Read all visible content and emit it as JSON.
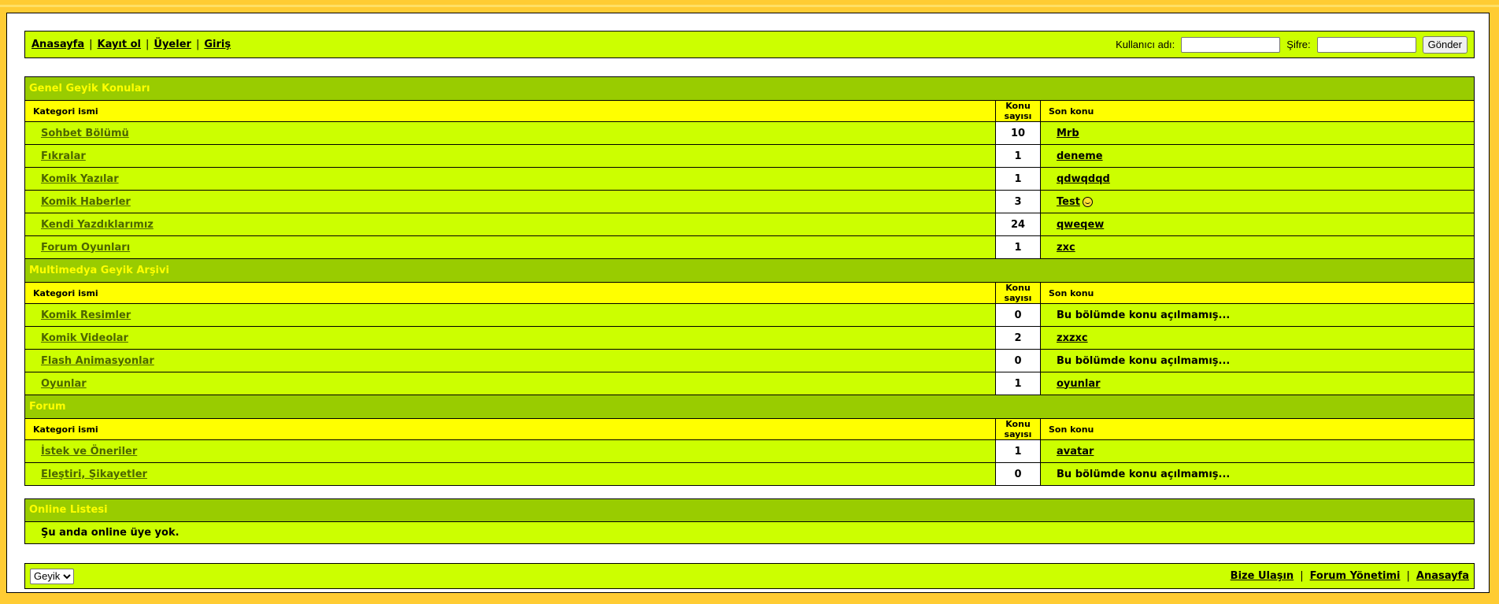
{
  "nav": {
    "links": [
      "Anasayfa",
      "Kayıt ol",
      "Üyeler",
      "Giriş"
    ],
    "username_label": "Kullanıcı adı:",
    "password_label": "Şifre:",
    "submit_label": "Gönder"
  },
  "columns": {
    "category": "Kategori ismi",
    "count": "Konu sayısı",
    "last": "Son konu"
  },
  "sections": [
    {
      "title": "Genel Geyik Konuları",
      "rows": [
        {
          "name": "Sohbet Bölümü",
          "count": "10",
          "last": "Mrb"
        },
        {
          "name": "Fıkralar",
          "count": "1",
          "last": "deneme"
        },
        {
          "name": "Komik Yazılar",
          "count": "1",
          "last": "qdwqdqd"
        },
        {
          "name": "Komik Haberler",
          "count": "3",
          "last": "Test"
        },
        {
          "name": "Kendi Yazdıklarımız",
          "count": "24",
          "last": "qweqew"
        },
        {
          "name": "Forum Oyunları",
          "count": "1",
          "last": "zxc"
        }
      ]
    },
    {
      "title": "Multimedya Geyik Arşivi",
      "rows": [
        {
          "name": "Komik Resimler",
          "count": "0",
          "last": "Bu bölümde konu açılmamış..."
        },
        {
          "name": "Komik Videolar",
          "count": "2",
          "last": "zxzxc"
        },
        {
          "name": "Flash Animasyonlar",
          "count": "0",
          "last": "Bu bölümde konu açılmamış..."
        },
        {
          "name": "Oyunlar",
          "count": "1",
          "last": "oyunlar"
        }
      ]
    },
    {
      "title": "Forum",
      "rows": [
        {
          "name": "İstek ve Öneriler",
          "count": "1",
          "last": "avatar"
        },
        {
          "name": "Eleştiri, Şikayetler",
          "count": "0",
          "last": "Bu bölümde konu açılmamış..."
        }
      ]
    }
  ],
  "online": {
    "title": "Online Listesi",
    "text": "Şu anda online üye yok."
  },
  "footer": {
    "theme_selected": "Geyik",
    "links": [
      "Bize Ulaşın",
      "Forum Yönetimi",
      "Anasayfa"
    ]
  },
  "icons": {
    "smiley": "smiley-icon"
  }
}
